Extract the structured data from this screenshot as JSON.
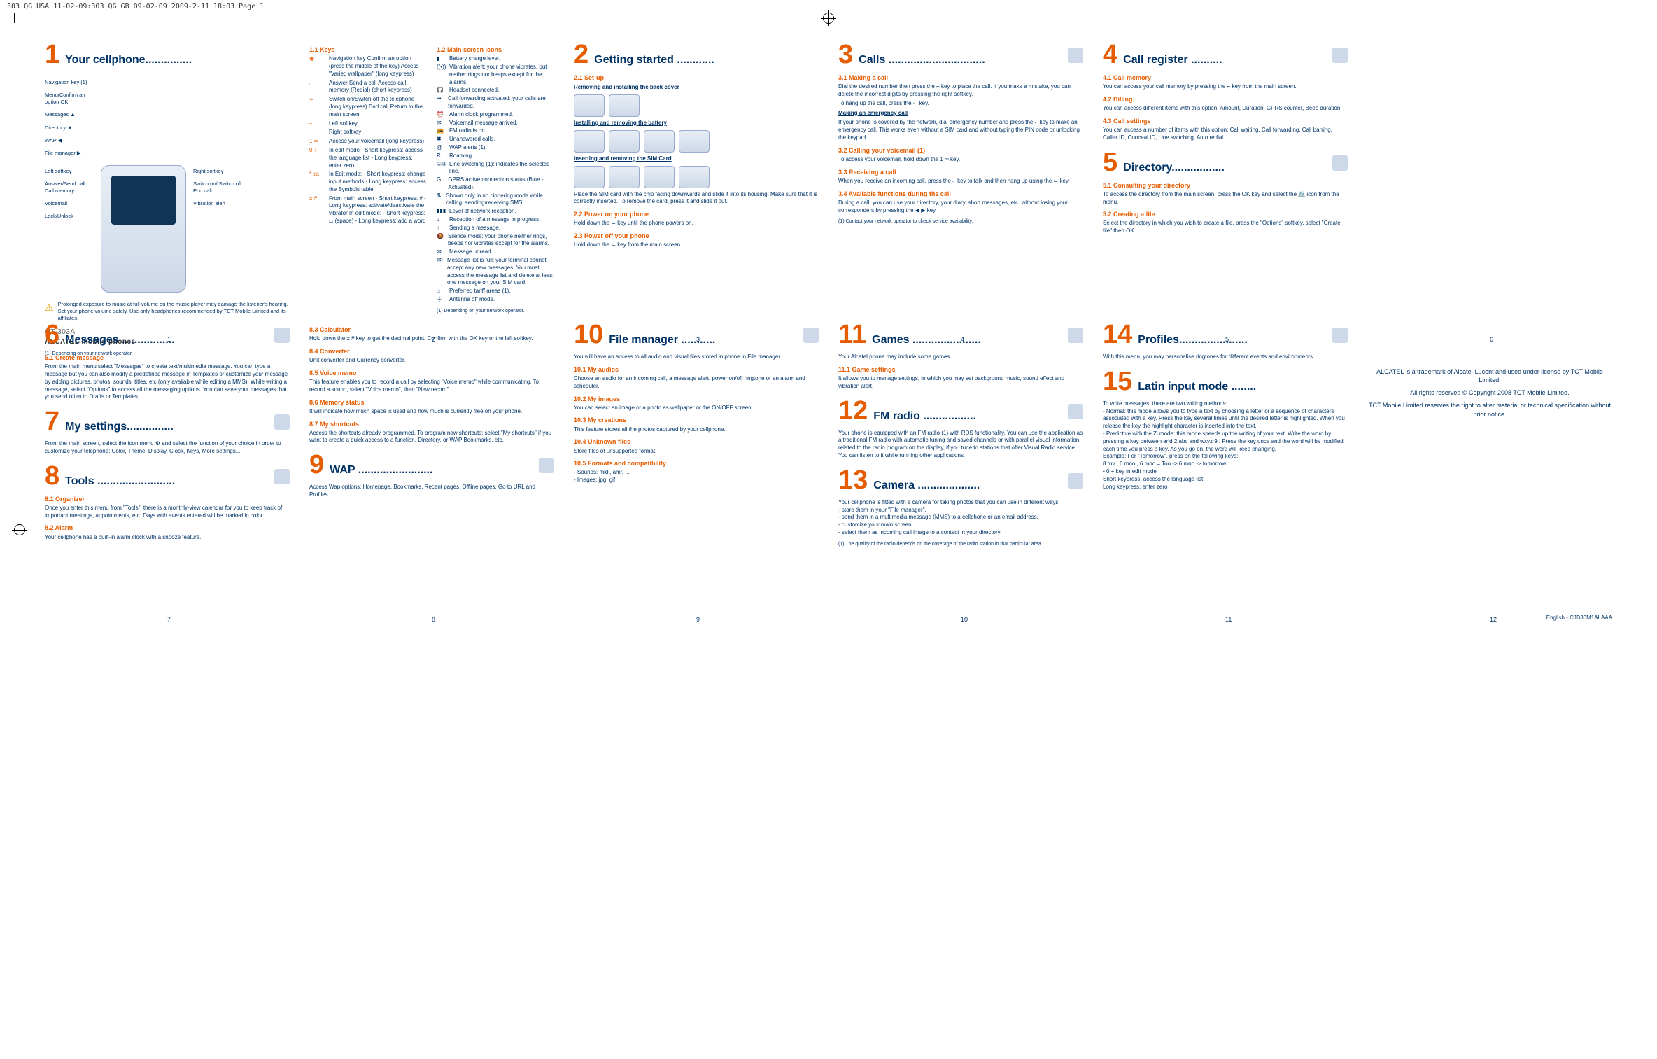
{
  "meta": {
    "header_line": "303_QG_USA_11-02-09:303_QG_GB_09-02-09  2009-2-11  18:03  Page 1",
    "footer_right_lang": "English - CJB30M1ALAAA"
  },
  "panel1": {
    "num": "1",
    "title": "Your cellphone...............",
    "labels_left": [
      "Navigation key (1)",
      "Menu/Confirm an option OK",
      "Messages ▲",
      "Directory ▼",
      "WAP ◀",
      "File manager ▶"
    ],
    "labels_left2": [
      "Left softkey",
      "Answer/Send call Call memory",
      "Voicemail",
      "Lock/Unlock"
    ],
    "labels_right": [
      "Right softkey",
      "Switch on/ Switch off End call",
      "Vibration alert"
    ],
    "warning": "Prolonged exposure to music at full volume on the music player may damage the listener's hearing. Set your phone volume safely. Use only headphones recommended by TCT Mobile Limited and its affiliates.",
    "model": "OT-303A",
    "brand": "ALCATEL mobile phones",
    "footnote": "(1) Depending on your network operator.",
    "page": "1"
  },
  "panel2": {
    "sub11": "1.1   Keys",
    "keys": [
      {
        "sym": "◉",
        "desc": "Navigation key\nConfirm an option (press the middle of the key)\nAccess \"Varied wallpaper\" (long keypress)"
      },
      {
        "sym": "⌐",
        "desc": "Answer\nSend a call\nAccess call memory (Redial) (short keypress)"
      },
      {
        "sym": "⌙",
        "desc": "Switch on/Switch off the telephone (long keypress)\nEnd call\nReturn to the main screen"
      },
      {
        "sym": "⎯",
        "desc": "Left softkey"
      },
      {
        "sym": "⎯",
        "desc": "Right softkey"
      },
      {
        "sym": "1 ∞",
        "desc": "Access your voicemail (long keypress)"
      },
      {
        "sym": "0 +",
        "desc": "In edit mode\n - Short keypress: access the language list\n - Long keypress: enter zero"
      },
      {
        "sym": "* ↕a",
        "desc": "In Edit mode:\n - Short keypress: change input methods\n - Long keypress: access the Symbols table"
      },
      {
        "sym": "± #",
        "desc": "From main screen\n - Short keypress: #\n - Long keypress: activate/deactivate the vibrator\nIn edit mode:\n - Short keypress: ⌴ (space)\n - Long keypress: add a word"
      }
    ],
    "sub12": "1.2   Main screen icons",
    "icons": [
      {
        "ic": "▮",
        "txt": "Battery charge level."
      },
      {
        "ic": "((•))",
        "txt": "Vibration alert: your phone vibrates, but neither rings nor beeps except for the alarms."
      },
      {
        "ic": "🎧",
        "txt": "Headset connected."
      },
      {
        "ic": "↪",
        "txt": "Call forwarding activated: your calls are forwarded."
      },
      {
        "ic": "⏰",
        "txt": "Alarm clock programmed."
      },
      {
        "ic": "✉",
        "txt": "Voicemail message arrived."
      },
      {
        "ic": "📻",
        "txt": "FM radio is on."
      },
      {
        "ic": "✖",
        "txt": "Unanswered calls."
      },
      {
        "ic": "@",
        "txt": "WAP alerts (1)."
      },
      {
        "ic": "R",
        "txt": "Roaming."
      },
      {
        "ic": "①②",
        "txt": "Line switching (1): indicates the selected line."
      },
      {
        "ic": "G",
        "txt": "GPRS active connection status (Blue - Activated)."
      },
      {
        "ic": "⇅",
        "txt": "Shown only in no ciphering mode while calling, sending/receiving SMS."
      },
      {
        "ic": "▮▮▮",
        "txt": "Level of network reception."
      },
      {
        "ic": "↓",
        "txt": "Reception of a message in progress."
      },
      {
        "ic": "↑",
        "txt": "Sending a message."
      },
      {
        "ic": "🔕",
        "txt": "Silence mode: your phone neither rings, beeps nor vibrates except for the alarms."
      },
      {
        "ic": "✉",
        "txt": "Message unread."
      },
      {
        "ic": "✉!",
        "txt": "Message list is full: your terminal cannot accept any new messages. You must access the message list and delete at least one message on your SIM card."
      },
      {
        "ic": "⌂",
        "txt": "Preferred tariff areas (1)."
      },
      {
        "ic": "⏚",
        "txt": "Antenna off mode."
      }
    ],
    "footnote": "(1) Depending on your network operator.",
    "page": "2"
  },
  "panel3": {
    "num": "2",
    "title": "Getting started  ............",
    "s21": "2.1   Set-up",
    "s21a": "Removing and installing the back cover",
    "s21b": "Installing and removing the battery",
    "s21c": "Inserting and removing the SIM Card",
    "s21c_body": "Place the SIM card with the chip facing downwards and slide it into its housing. Make sure that it is correctly inserted. To remove the card, press it and slide it out.",
    "s22": "2.2   Power on your phone",
    "s22_body": "Hold down the ⌙ key until the phone powers on.",
    "s23": "2.3   Power off your phone",
    "s23_body": "Hold down the ⌙ key from the main screen.",
    "page": "3"
  },
  "panel4": {
    "num": "3",
    "title": "Calls  ...............................",
    "s31": "3.1   Making a call",
    "s31_body": "Dial the desired number then press the ⌐ key to place the call. If you make a mistake, you can delete the incorrect digits by pressing the right softkey.",
    "s31_body2": "To hang up the call, press the ⌙ key.",
    "s31_sub": "Making an emergency call",
    "s31_sub_body": "If your phone is covered by the network, dial emergency number and press the ⌐ key to make an emergency call. This works even without a SIM card and without typing the PIN code or unlocking the keypad.",
    "s32": "3.2   Calling your voicemail (1)",
    "s32_body": "To access your voicemail, hold down the 1 ∞ key.",
    "s33": "3.3   Receiving a call",
    "s33_body": "When you receive an incoming call, press the ⌐ key to talk and then hang up using the ⌙ key.",
    "s34": "3.4   Available functions during the call",
    "s34_body": "During a call, you can use your directory, your diary, short messages, etc. without losing your correspondent by pressing the ◀ ▶ key.",
    "footnote": "(1) Contact your network operator to check service availability.",
    "page": "4"
  },
  "panel5": {
    "num": "4",
    "title": "Call register  ..........",
    "s41": "4.1   Call memory",
    "s41_body": "You can access your call memory by pressing the ⌐ key from the main screen.",
    "s42": "4.2   Billing",
    "s42_body": "You can access different items with this option: Amount, Duration, GPRS counter, Beep duration.",
    "s43": "4.3   Call settings",
    "s43_body": "You can access a number of items with this option: Call waiting, Call forwarding, Call barring, Caller ID, Conceal ID, Line switching, Auto redial.",
    "num5": "5",
    "title5": "Directory.................",
    "s51": "5.1   Consulting your directory",
    "s51_body": "To access the directory from the main screen, press the OK key and select the 📇 icon from the menu.",
    "s52": "5.2   Creating a file",
    "s52_body": "Select the directory in which you wish to create a file, press the \"Options\" softkey, select \"Create file\" then OK.",
    "page": "5"
  },
  "panel6": {
    "page": "6"
  },
  "panel7": {
    "num": "6",
    "title": "Messages  .................",
    "s61": "6.1   Create message",
    "s61_body": "From the main menu select \"Messages\" to create text/multimedia message. You can type a message but you can also modify a predefined message in Templates or customize your message by adding pictures, photos, sounds, titles, etc (only available while editing a MMS). While writing a message, select \"Options\" to access all the messaging options. You can save your messages that you send often to Drafts or Templates.",
    "num7": "7",
    "title7": "My settings...............",
    "s7_body": "From the main screen, select the icon menu ⚙ and select the function of your choice in order to customize your telephone: Color, Theme, Display, Clock, Keys, More settings...",
    "num8": "8",
    "title8": "Tools .........................",
    "s81": "8.1   Organizer",
    "s81_body": "Once you enter this menu from \"Tools\", there is a monthly-view calendar for you to keep track of important meetings, appointments, etc. Days with events entered will be marked in color.",
    "s82": "8.2   Alarm",
    "s82_body": "Your cellphone has a built-in alarm clock with a snooze feature.",
    "page": "7"
  },
  "panel8": {
    "s83": "8.3   Calculator",
    "s83_body": "Hold down the ± # key to get the decimal point. Confirm with the OK key or the left softkey.",
    "s84": "8.4   Converter",
    "s84_body": "Unit converter and Currency converter.",
    "s85": "8.5   Voice memo",
    "s85_body": "This feature enables you to record a call by selecting \"Voice memo\" while communicating. To record a sound, select \"Voice memo\", then \"New record\".",
    "s86": "8.6   Memory status",
    "s86_body": "It will indicate how much space is used and how much is currently free on your phone.",
    "s87": "8.7   My shortcuts",
    "s87_body": "Access the shortcuts already programmed. To program new shortcuts: select \"My shortcuts\" if you want to create a quick access to a function, Directory, or WAP Bookmarks, etc.",
    "num9": "9",
    "title9": "WAP  ........................",
    "s9_body": "Access Wap options: Homepage, Bookmarks, Recent pages, Offline pages, Go to URL and Profiles.",
    "page": "8"
  },
  "panel9": {
    "num": "10",
    "title": "File manager ...........",
    "body": "You will have an access to all audio and visual files stored in phone in File manager.",
    "s101": "10.1   My audios",
    "s101_body": "Choose an audio for an incoming call, a message alert, power on/off ringtone or an alarm and scheduler.",
    "s102": "10.2   My images",
    "s102_body": "You can select an image or a photo as wallpaper or the ON/OFF screen.",
    "s103": "10.3   My creations",
    "s103_body": "This feature stores all the photos captured by your cellphone.",
    "s104": "10.4   Unknown files",
    "s104_body": "Store files of unsupported format.",
    "s105": "10.5   Formats and compatibility",
    "s105_body": "- Sounds: midi, amr, ...\n- Images: jpg, gif",
    "page": "9"
  },
  "panel10": {
    "num": "11",
    "title": "Games ......................",
    "body": "Your Alcatel phone may include some games.",
    "s111": "11.1   Game settings",
    "s111_body": "It allows you to manage settings, in which you may set background music, sound effect and vibration alert.",
    "num12": "12",
    "title12": "FM radio  .................",
    "s12_body": "Your phone is equipped with an FM radio (1) with RDS functionality. You can use the application as a traditional FM radio with automatic tuning and saved channels or with parallel visual information related to the radio program on the display, if you tune to stations that offer Visual Radio service. You can listen to it while running other applications.",
    "num13": "13",
    "title13": "Camera ....................",
    "s13_body": "Your cellphone is fitted with a camera for taking photos that you can use in different ways:\n- store them in your \"File manager\".\n- send them in a multimedia message (MMS) to a cellphone or an email address.\n- customize your main screen.\n- select them as incoming call image to a contact in your directory.",
    "footnote": "(1) The quality of the radio depends on the coverage of the radio station in that particular area.",
    "page": "10"
  },
  "panel11": {
    "num": "14",
    "title": "Profiles......................",
    "body": "With this menu, you may personalise ringtones for different events and environments.",
    "num15": "15",
    "title15": "Latin input mode  ........",
    "s15_body": "To write messages, there are two writing methods:\n- Normal: this mode allows you to type a text by choosing a letter or a sequence of characters associated with a key. Press the key several times until the desired letter is highlighted. When you release the key the highlight character is inserted into the text.\n- Predictive with the Zi mode: this mode speeds up the writing of your text. Write the word by pressing a key between and 2 abc and wxyz 9 . Press the key once and the word will be modified each time you press a key. As you go on, the word will keep changing.\nExample: For \"Tomorrow\", press on the following keys:\n8 tuv , 6 mno , 6 mno = Too -> 6 mno -> tomorrow\n• 0 + key in edit mode\nShort keypress: access the language list\nLong keypress: enter zero",
    "page": "11"
  },
  "panel12": {
    "legal1": "ALCATEL is a trademark of Alcatel-Lucent and used under license by TCT Mobile Limited.",
    "legal2": "All rights reserved © Copyright 2008 TCT Mobile Limited.",
    "legal3": "TCT Mobile Limited reserves the right to alter material or technical specification without prior notice.",
    "page": "12"
  }
}
